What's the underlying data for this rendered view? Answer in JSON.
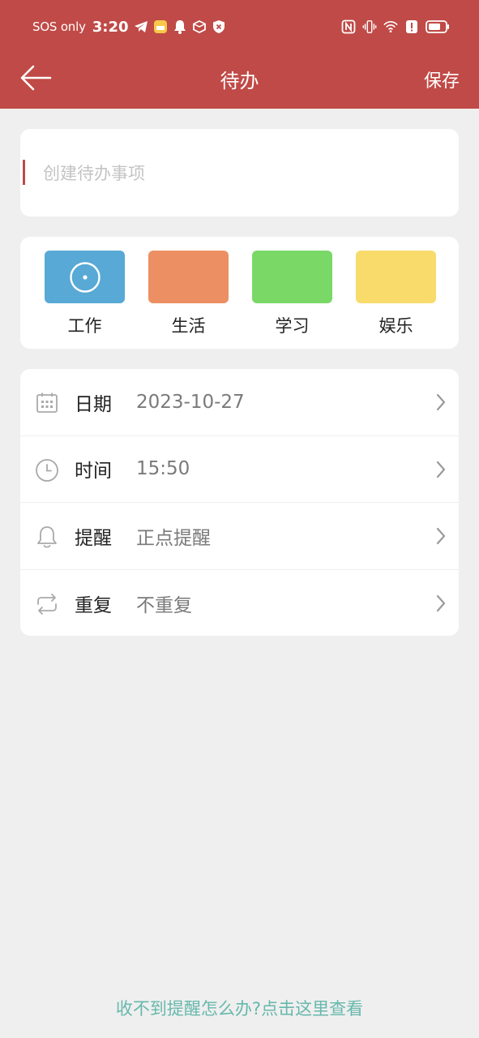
{
  "status_bar": {
    "carrier": "SOS only",
    "time": "3:20",
    "icons_left": [
      "telegram-icon",
      "app-notification-icon",
      "bell-icon",
      "box-icon",
      "shield-icon"
    ],
    "icons_right": [
      "nfc-icon",
      "vibrate-icon",
      "wifi-icon",
      "alert-icon",
      "battery-icon"
    ]
  },
  "header": {
    "title": "待办",
    "save_label": "保存",
    "back_icon": "arrow-left-icon"
  },
  "todo_input": {
    "placeholder": "创建待办事项",
    "value": ""
  },
  "categories": [
    {
      "label": "工作",
      "color": "#58a9d5",
      "selected": true
    },
    {
      "label": "生活",
      "color": "#ec9063"
    },
    {
      "label": "学习",
      "color": "#7ad867"
    },
    {
      "label": "娱乐",
      "color": "#f8db6b"
    }
  ],
  "settings": [
    {
      "icon": "calendar-icon",
      "label": "日期",
      "value": "2023-10-27"
    },
    {
      "icon": "clock-icon",
      "label": "时间",
      "value": "15:50"
    },
    {
      "icon": "bell-icon",
      "label": "提醒",
      "value": "正点提醒"
    },
    {
      "icon": "repeat-icon",
      "label": "重复",
      "value": "不重复"
    }
  ],
  "help_link": "收不到提醒怎么办?点击这里查看",
  "colors": {
    "accent": "#c04a47",
    "background": "#efefef",
    "link": "#67b8ac"
  }
}
